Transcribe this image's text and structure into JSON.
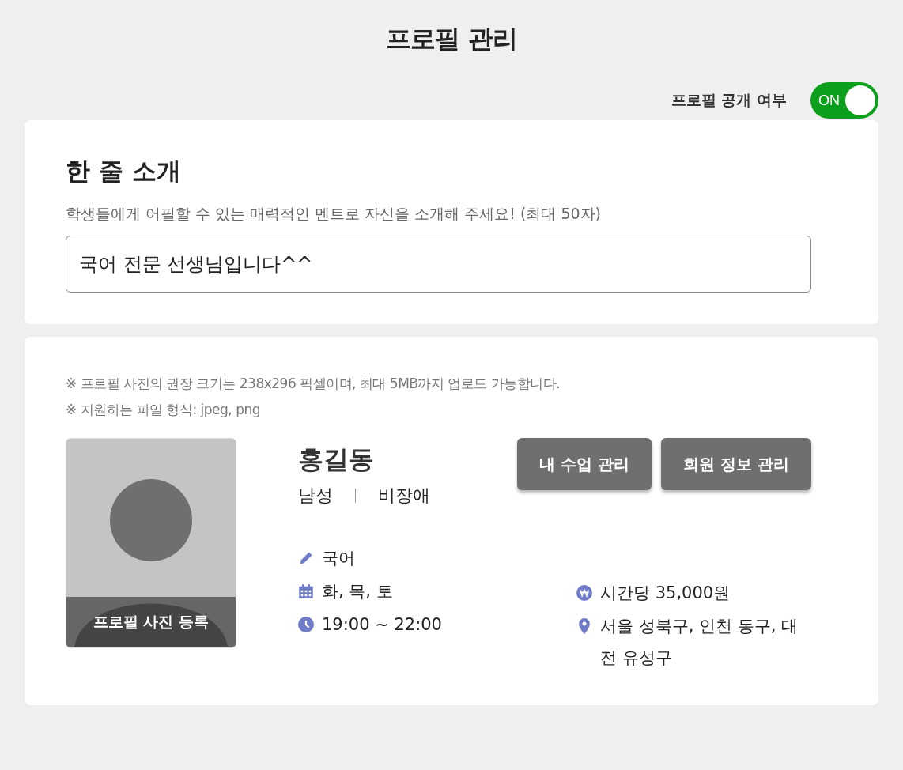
{
  "page_title": "프로필 관리",
  "visibility": {
    "label": "프로필 공개 여부",
    "on": true,
    "on_text": "ON"
  },
  "intro": {
    "heading": "한 줄 소개",
    "description": "학생들에게 어필할 수 있는 매력적인 멘트로 자신을 소개해 주세요! (최대 50자)",
    "value": "국어 전문 선생님입니다^^"
  },
  "profile": {
    "notes": [
      "※ 프로필 사진의 권장 크기는 238x296 픽셀이며, 최대 5MB까지 업로드 가능합니다.",
      "※ 지원하는 파일 형식: jpeg, png"
    ],
    "photo_label": "프로필 사진 등록",
    "name": "홍길동",
    "gender": "남성",
    "disability": "비장애",
    "buttons": [
      "내 수업 관리",
      "회원 정보 관리"
    ],
    "details_left": [
      {
        "kind": "subject",
        "text": "국어"
      },
      {
        "kind": "days",
        "text": "화, 목, 토"
      },
      {
        "kind": "time",
        "text": "19:00 ~ 22:00"
      }
    ],
    "details_right": [
      {
        "kind": "price",
        "text": "시간당 35,000원"
      },
      {
        "kind": "location",
        "text": "서울 성북구, 인천 동구, 대전 유성구"
      }
    ]
  }
}
